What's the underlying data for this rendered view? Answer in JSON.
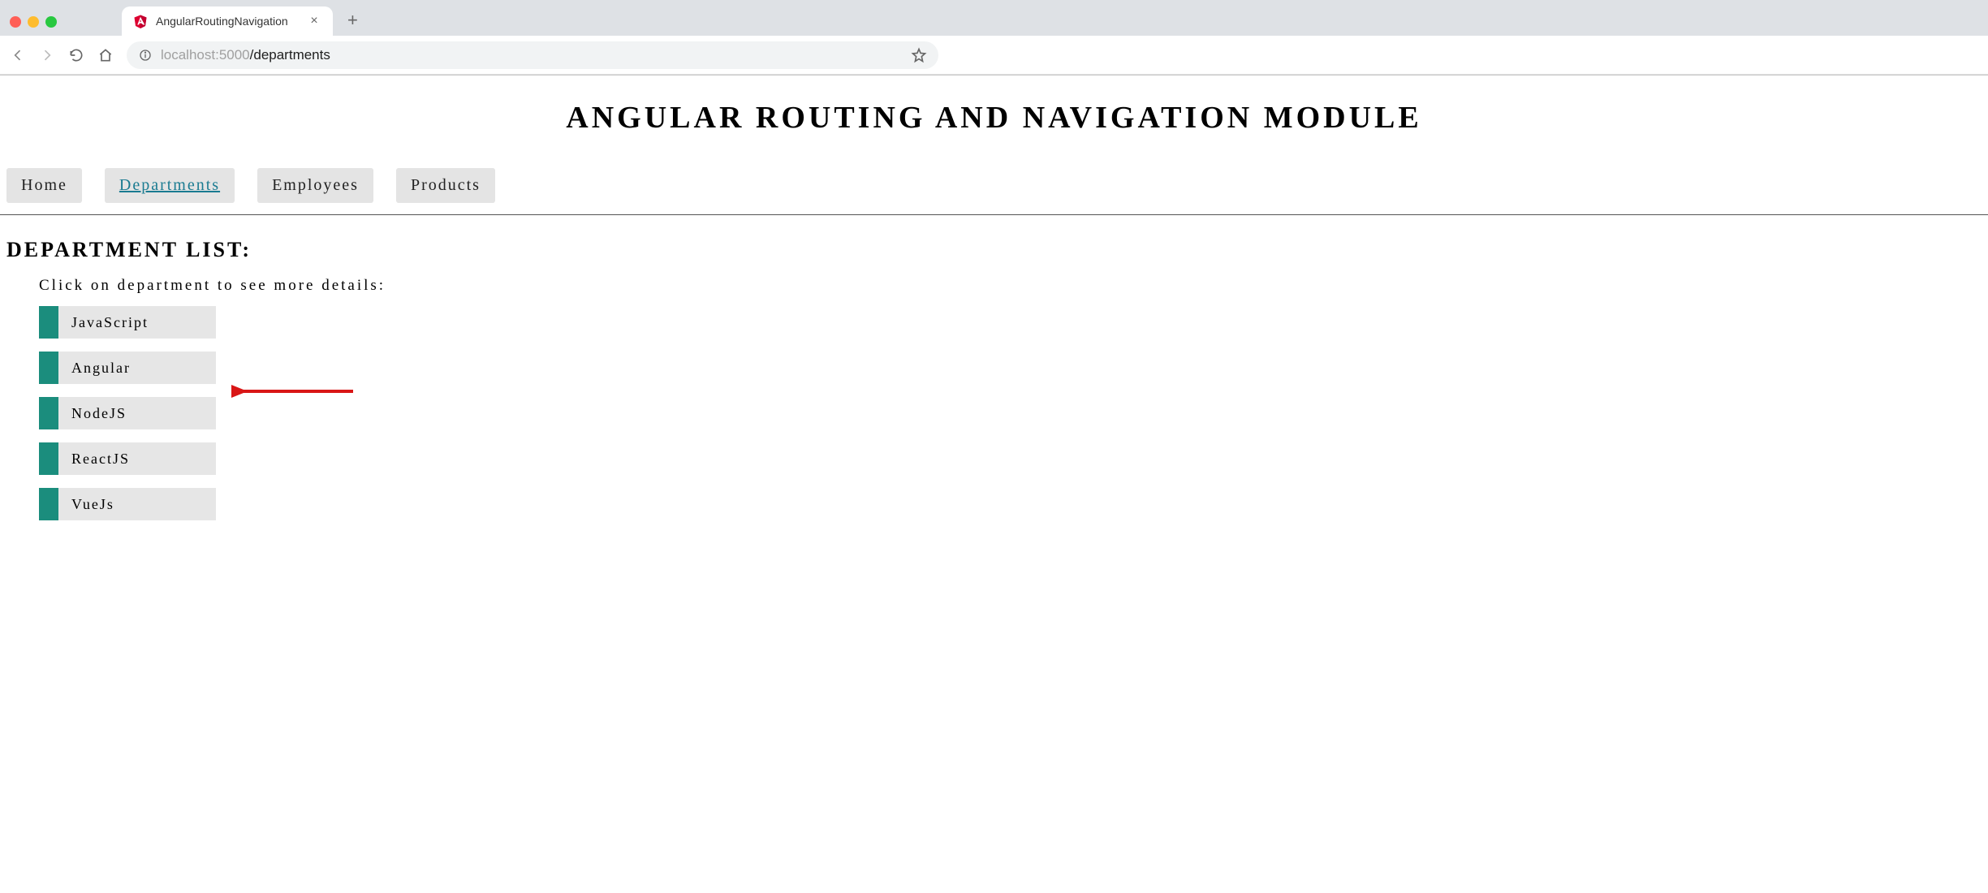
{
  "browser": {
    "tab_title": "AngularRoutingNavigation",
    "url_host": "localhost:5000",
    "url_path": "/departments"
  },
  "page": {
    "title": "ANGULAR ROUTING AND NAVIGATION MODULE",
    "nav": [
      {
        "label": "Home",
        "active": false
      },
      {
        "label": "Departments",
        "active": true
      },
      {
        "label": "Employees",
        "active": false
      },
      {
        "label": "Products",
        "active": false
      }
    ],
    "section_heading": "DEPARTMENT LIST:",
    "section_subtext": "Click on department to see more details:",
    "departments": [
      {
        "name": "JavaScript"
      },
      {
        "name": "Angular"
      },
      {
        "name": "NodeJS"
      },
      {
        "name": "ReactJS"
      },
      {
        "name": "VueJs"
      }
    ]
  }
}
